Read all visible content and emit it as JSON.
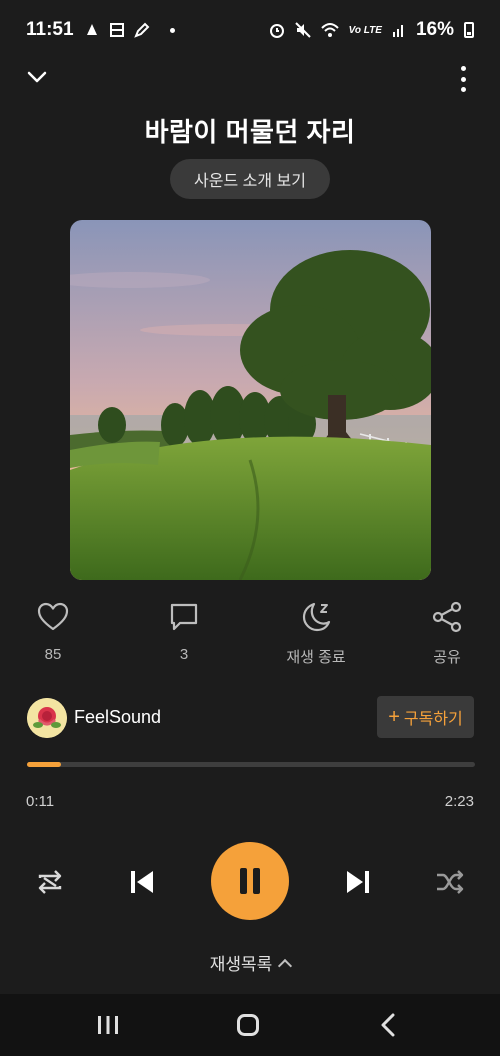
{
  "status": {
    "time": "11:51",
    "network_label": "Vo LTE",
    "battery_pct": "16%",
    "left_icons": [
      "notification-icon",
      "grid-icon",
      "pencil-icon",
      "dot-icon"
    ],
    "right_icons": [
      "alarm-icon",
      "mute-icon",
      "wifi-icon",
      "signal-icon",
      "battery-icon"
    ]
  },
  "header": {
    "title": "바람이 머물던 자리",
    "intro_button": "사운드 소개 보기"
  },
  "actions": {
    "like_count": "85",
    "comment_count": "3",
    "sleep_timer_label": "재생 종료",
    "share_label": "공유"
  },
  "channel": {
    "name": "FeelSound",
    "subscribe_label": "구독하기"
  },
  "playback": {
    "current_time": "0:11",
    "total_time": "2:23",
    "progress_fraction": 0.077
  },
  "playlist_label": "재생목록",
  "colors": {
    "accent": "#f5a13a",
    "background": "#1c1c1c",
    "surface": "#3a3a3a"
  }
}
